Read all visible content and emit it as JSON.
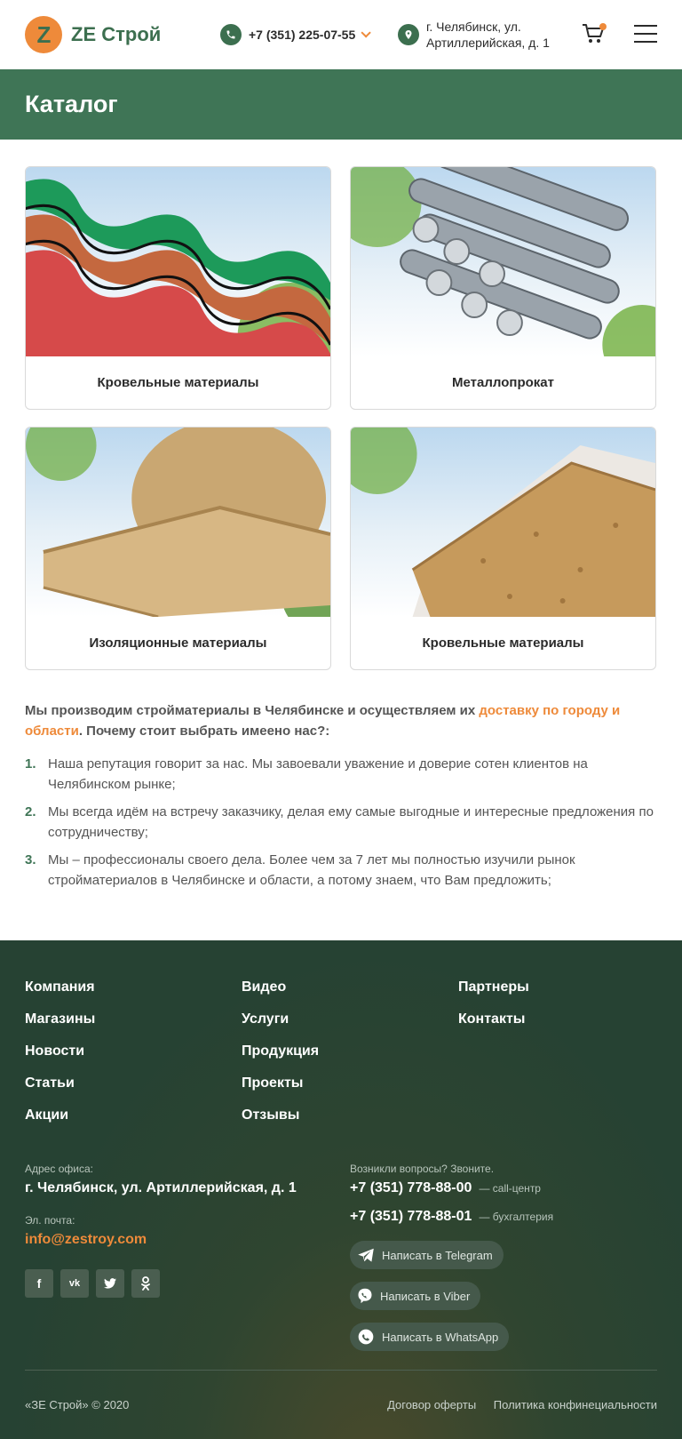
{
  "header": {
    "logo_letter": "Z",
    "logo_text": "ZE Строй",
    "phone": "+7 (351) 225-07-55",
    "address_line1": "г. Челябинск, ул.",
    "address_line2": "Артиллерийская, д. 1",
    "accent_color": "#ee8a3a",
    "brand_color": "#3c6f4f"
  },
  "page_title": "Каталог",
  "catalog": [
    {
      "label": "Кровельные материалы",
      "icon": "roofing-sheets"
    },
    {
      "label": "Металлопрокат",
      "icon": "rebar-bundle"
    },
    {
      "label": "Изоляционные материалы",
      "icon": "insulation-roll"
    },
    {
      "label": "Кровельные материалы",
      "icon": "chipboard-stack"
    }
  ],
  "intro": {
    "before": "Мы производим стройматериалы в Челябинске и осуществляем их ",
    "link": "доставку по городу и области",
    "after": ". Почему стоит выбрать имеено нас?:"
  },
  "reasons": [
    {
      "num": "1.",
      "text": "Наша репутация говорит за нас. Мы завоевали уважение и доверие сотен клиентов на Челябинском рынке;"
    },
    {
      "num": "2.",
      "text": "Мы всегда идём на встречу заказчику, делая ему самые выгодные и интересные предложения по сотрудничеству;"
    },
    {
      "num": "3.",
      "text": "Мы – профессионалы своего дела. Более чем за 7 лет мы полностью изучили рынок стройматериалов в Челябинске и области, а потому знаем, что Вам предложить;"
    }
  ],
  "footer": {
    "nav_col1": [
      "Компания",
      "Магазины",
      "Новости",
      "Статьи",
      "Акции"
    ],
    "nav_col2": [
      "Видео",
      "Услуги",
      "Продукция",
      "Проекты",
      "Отзывы"
    ],
    "nav_col3": [
      "Партнеры",
      "Контакты"
    ],
    "office_label": "Адрес офиса:",
    "office_address": "г. Челябинск, ул. Артиллерийская, д. 1",
    "email_label": "Эл. почта:",
    "email": "info@zestroy.com",
    "social": [
      "f",
      "vk",
      "tw",
      "ok"
    ],
    "questions_label": "Возникли вопросы? Звоните.",
    "phones": [
      {
        "number": "+7 (351) 778-88-00",
        "desc": "— call-центр"
      },
      {
        "number": "+7 (351) 778-88-01",
        "desc": "— бухгалтерия"
      }
    ],
    "messengers": [
      {
        "label": "Написать в Telegram",
        "icon": "telegram-icon"
      },
      {
        "label": "Написать в Viber",
        "icon": "viber-icon"
      },
      {
        "label": "Написать в WhatsApp",
        "icon": "whatsapp-icon"
      }
    ],
    "copyright": "«ЗЕ Строй» © 2020",
    "link_offer": "Договор оферты",
    "link_privacy": "Политика конфинециальности"
  }
}
